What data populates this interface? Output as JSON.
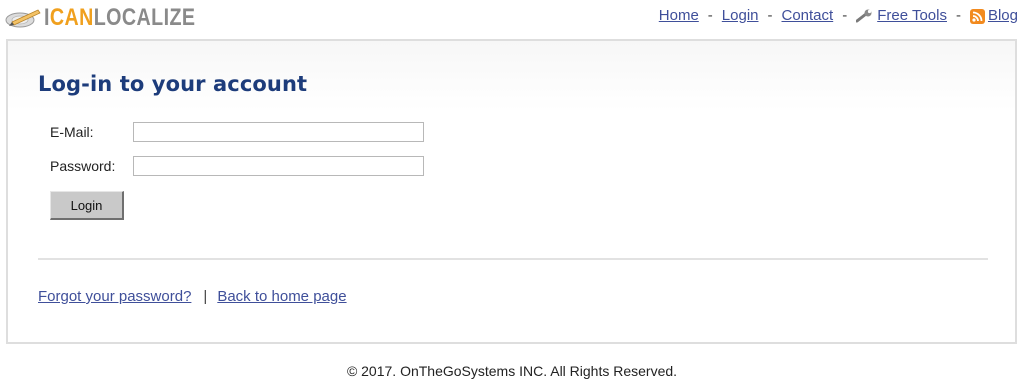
{
  "header": {
    "logo": {
      "text_part1": "I",
      "text_part2": "CAN",
      "text_part3": "LOCALIZE",
      "icon": "globe-pen-logo-icon"
    },
    "nav": {
      "home": "Home",
      "login": "Login",
      "contact": "Contact",
      "free_tools": "Free Tools",
      "blog": "Blog",
      "separator": "-",
      "free_tools_icon": "wrench-icon",
      "blog_icon": "rss-icon"
    }
  },
  "main": {
    "title": "Log-in to your account",
    "email_label": "E-Mail:",
    "email_value": "",
    "password_label": "Password:",
    "password_value": "",
    "login_button": "Login",
    "forgot_link": "Forgot your password?",
    "link_separator": "|",
    "back_link": "Back to home page"
  },
  "footer": {
    "copyright": "© 2017. OnTheGoSystems INC. All Rights Reserved."
  },
  "colors": {
    "title": "#1d3c7b",
    "link": "#3f4f9a",
    "logo_orange": "#f0a01e",
    "logo_gray": "#8a8a8a",
    "button": "#c9c9c9"
  }
}
